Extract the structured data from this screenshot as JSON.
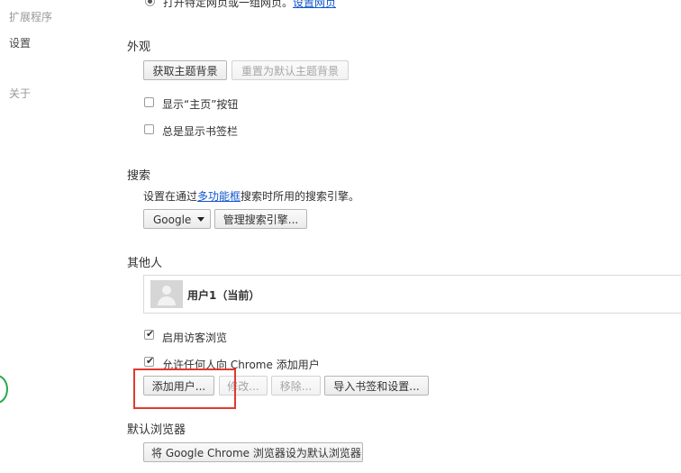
{
  "sidebar": {
    "items": [
      {
        "label": "扩展程序"
      },
      {
        "label": "设置"
      },
      {
        "label": "关于"
      }
    ]
  },
  "startup": {
    "option_text": "打开特定网页或一组网页。",
    "link": "设置网页"
  },
  "appearance": {
    "title": "外观",
    "get_theme": "获取主题背景",
    "reset_theme": "重置为默认主题背景",
    "show_home": "显示“主页”按钮",
    "show_bookmarks": "总是显示书签栏"
  },
  "search": {
    "title": "搜索",
    "desc_before": "设置在通过",
    "desc_link": "多功能框",
    "desc_after": "搜索时所用的搜索引擎。",
    "engine": "Google",
    "manage": "管理搜索引擎..."
  },
  "people": {
    "title": "其他人",
    "user_name": "用户1（当前）",
    "guest_browsing": "启用访客浏览",
    "allow_add": "允许任何人向 Chrome 添加用户",
    "add_user": "添加用户...",
    "edit": "修改...",
    "remove": "移除...",
    "import": "导入书签和设置..."
  },
  "default_browser": {
    "title": "默认浏览器",
    "set_default": "将 Google Chrome 浏览器设为默认浏览器"
  },
  "colors": {
    "highlight": "#e0392f",
    "link": "#1155cc",
    "accent_green": "#2aa84a"
  }
}
